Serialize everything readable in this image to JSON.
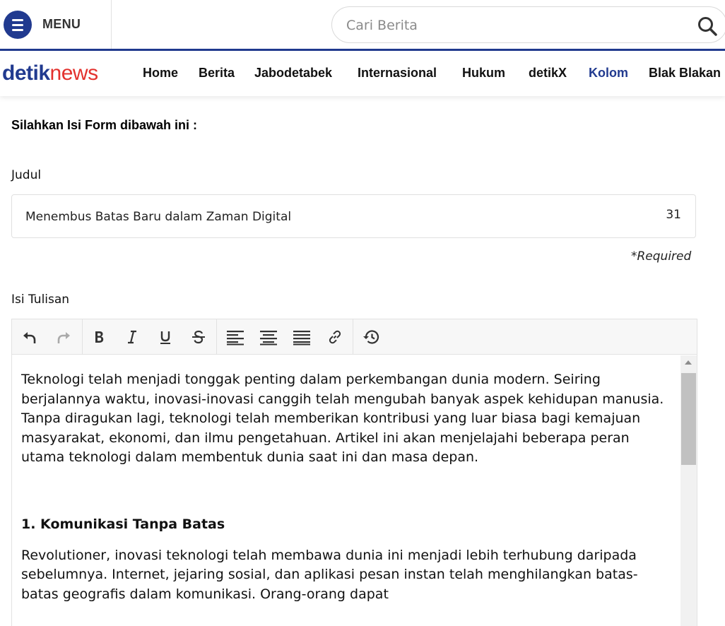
{
  "header": {
    "menu_label": "MENU",
    "search_placeholder": "Cari Berita"
  },
  "nav": {
    "logo_part1": "detik",
    "logo_part2": "news",
    "items": [
      {
        "label": "Home"
      },
      {
        "label": "Berita"
      },
      {
        "label": "Jabodetabek"
      },
      {
        "label": "Internasional"
      },
      {
        "label": "Hukum"
      },
      {
        "label": "detikX"
      },
      {
        "label": "Kolom",
        "active": true
      },
      {
        "label": "Blak Blakan"
      }
    ]
  },
  "form": {
    "heading": "Silahkan Isi Form dibawah ini :",
    "title_label": "Judul",
    "title_value": "Menembus Batas Baru dalam Zaman Digital",
    "title_char_count": "31",
    "required_note": "*Required",
    "body_label": "Isi Tulisan"
  },
  "editor": {
    "toolbar": [
      "undo-icon",
      "redo-icon",
      "bold-icon",
      "italic-icon",
      "underline-icon",
      "strikethrough-icon",
      "align-left-icon",
      "align-center-icon",
      "align-justify-icon",
      "link-icon",
      "history-icon"
    ],
    "paragraph1": "Teknologi telah menjadi tonggak penting dalam perkembangan dunia modern. Seiring berjalannya waktu, inovasi-inovasi canggih telah mengubah banyak aspek kehidupan manusia. Tanpa diragukan lagi, teknologi telah memberikan kontribusi yang luar biasa bagi kemajuan masyarakat, ekonomi, dan ilmu pengetahuan. Artikel ini akan menjelajahi beberapa peran utama teknologi dalam membentuk dunia saat ini dan masa depan.",
    "heading1": "1. Komunikasi Tanpa Batas",
    "paragraph2": "Revolutioner, inovasi teknologi telah membawa dunia ini menjadi lebih terhubung daripada sebelumnya. Internet, jejaring sosial, dan aplikasi pesan instan telah menghilangkan batas-batas geografis dalam komunikasi. Orang-orang dapat"
  },
  "colors": {
    "brand_blue": "#213a8f",
    "brand_red": "#e3312d"
  }
}
